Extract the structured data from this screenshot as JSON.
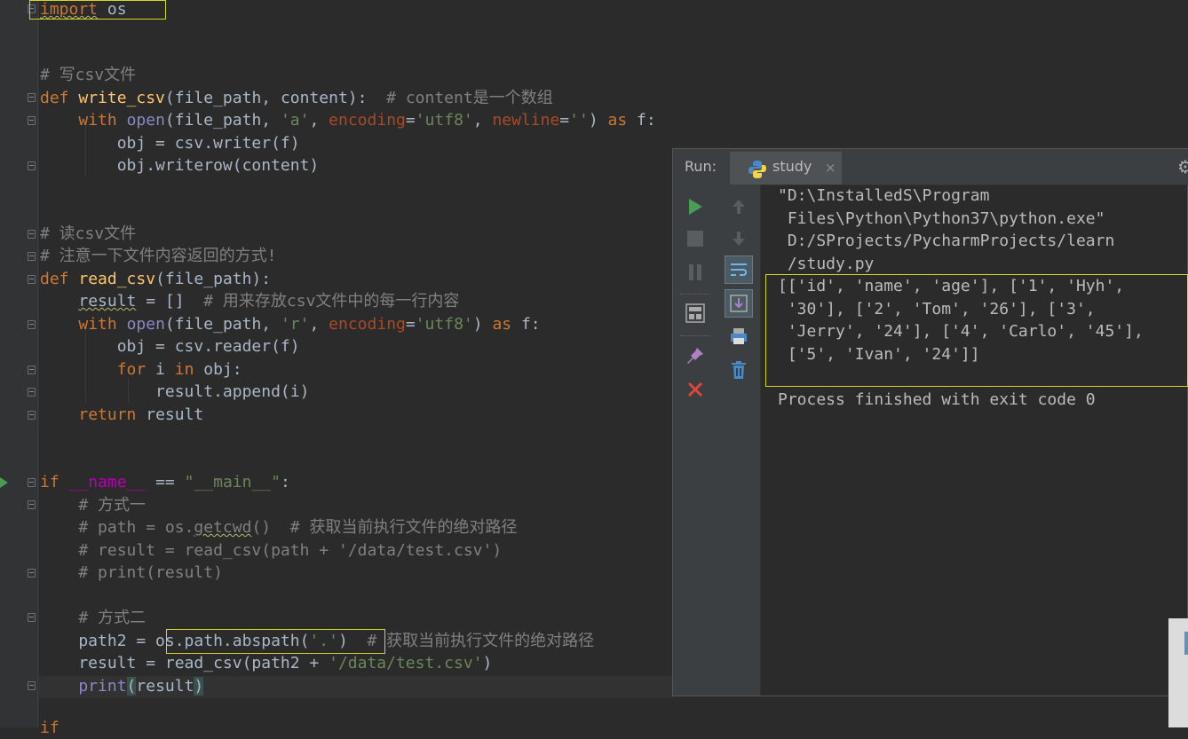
{
  "editor": {
    "lines": [
      {
        "n": "import-line",
        "text": "import os"
      },
      {
        "n": "comment-write",
        "text": "# 写csv文件"
      },
      {
        "n": "def-write",
        "text": "def write_csv(file_path, content):  # content是一个数组"
      },
      {
        "n": "with-open-a",
        "text": "with open(file_path, 'a', encoding='utf8', newline='') as f:"
      },
      {
        "n": "obj-writer",
        "text": "obj = csv.writer(f)"
      },
      {
        "n": "obj-writerow",
        "text": "obj.writerow(content)"
      },
      {
        "n": "comment-read",
        "text": "# 读csv文件"
      },
      {
        "n": "comment-note",
        "text": "# 注意一下文件内容返回的方式!"
      },
      {
        "n": "def-read",
        "text": "def read_csv(file_path):"
      },
      {
        "n": "result-init",
        "text": "result = []  # 用来存放csv文件中的每一行内容"
      },
      {
        "n": "with-open-r",
        "text": "with open(file_path, 'r', encoding='utf8') as f:"
      },
      {
        "n": "obj-reader",
        "text": "obj = csv.reader(f)"
      },
      {
        "n": "for-loop",
        "text": "for i in obj:"
      },
      {
        "n": "append",
        "text": "result.append(i)"
      },
      {
        "n": "return",
        "text": "return result"
      },
      {
        "n": "if-main",
        "text": "if __name__ == \"__main__\":"
      },
      {
        "n": "comment-way1",
        "text": "# 方式一"
      },
      {
        "n": "comment-path",
        "text": "# path = os.getcwd()  # 获取当前执行文件的绝对路径"
      },
      {
        "n": "comment-result",
        "text": "# result = read_csv(path + '/data/test.csv')"
      },
      {
        "n": "comment-print",
        "text": "# print(result)"
      },
      {
        "n": "comment-way2",
        "text": "# 方式二"
      },
      {
        "n": "path2",
        "text": "path2 = os.path.abspath('.')  # 获取当前执行文件的绝对路径"
      },
      {
        "n": "result-call",
        "text": "result = read_csv(path2 + '/data/test.csv')"
      },
      {
        "n": "print",
        "text": "print(result)"
      }
    ]
  },
  "run_panel": {
    "label": "Run:",
    "tab_label": "study",
    "close_glyph": "×",
    "console": [
      "\"D:\\InstalledS\\Program",
      " Files\\Python\\Python37\\python.exe\"",
      " D:/SProjects/PycharmProjects/learn",
      " /study.py",
      "[['id', 'name', 'age'], ['1', 'Hyh',",
      " '30'], ['2', 'Tom', '26'], ['3',",
      " 'Jerry', '24'], ['4', 'Carlo', '45'],",
      " ['5', 'Ivan', '24']]",
      "",
      "Process finished with exit code 0"
    ]
  },
  "icons": {
    "rerun": "play-icon",
    "stop": "stop-icon",
    "pause": "pause-icon",
    "up": "arrow-up-icon",
    "down": "arrow-down-icon",
    "softwrap": "soft-wrap-icon",
    "scroll": "scroll-to-end-icon",
    "print": "print-icon",
    "trash": "trash-icon",
    "layout": "restore-layout-icon",
    "pin": "pin-icon",
    "close": "close-icon",
    "settings": "gear-icon"
  },
  "colors": {
    "keyword": "#cc7832",
    "function": "#ffc66d",
    "string": "#6a8759",
    "comment": "#808080",
    "builtin": "#8888c6",
    "highlight_box": "#d4d81f",
    "run_green": "#499c54"
  }
}
